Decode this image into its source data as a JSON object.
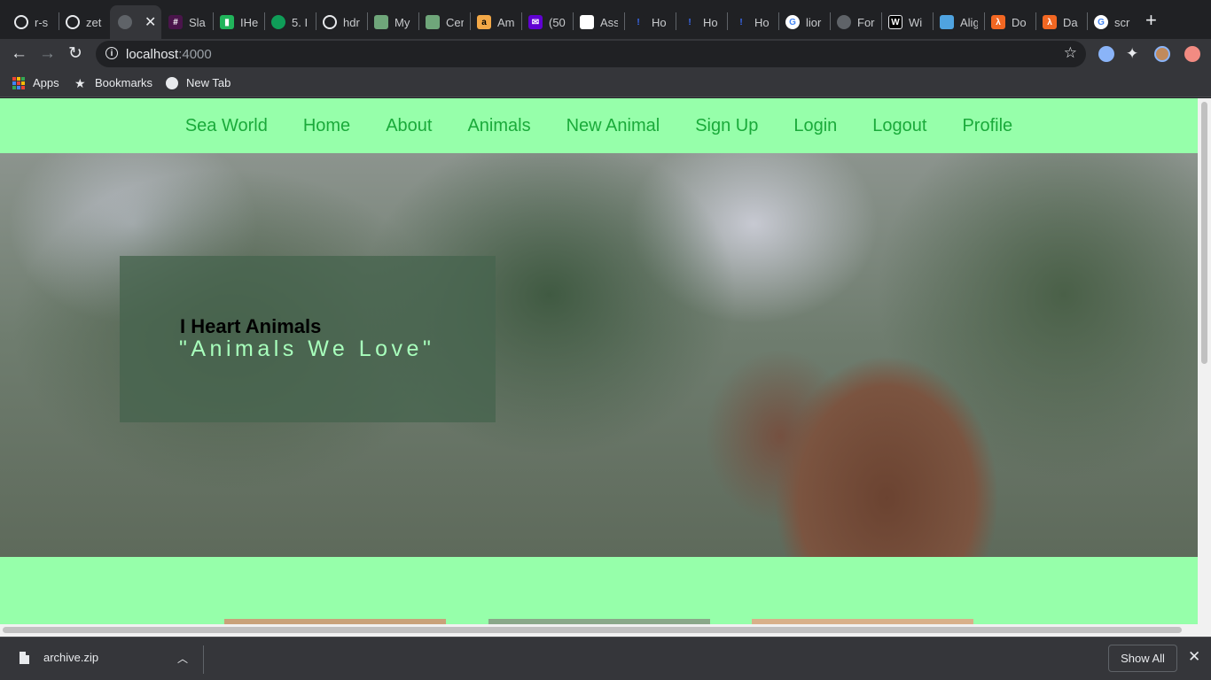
{
  "browser": {
    "tabs": [
      {
        "title": "r-s",
        "icon": "github-icon"
      },
      {
        "title": "zet",
        "icon": "github-icon"
      },
      {
        "title": "",
        "icon": "globe-icon",
        "active": true
      },
      {
        "title": "Sla",
        "icon": "slack-icon"
      },
      {
        "title": "IHe",
        "icon": "trello-icon"
      },
      {
        "title": "5. I",
        "icon": "leaf-icon"
      },
      {
        "title": "hdr",
        "icon": "github-icon"
      },
      {
        "title": "My",
        "icon": "app-icon"
      },
      {
        "title": "Cer",
        "icon": "app-icon"
      },
      {
        "title": "Am",
        "icon": "amazon-icon"
      },
      {
        "title": "(50",
        "icon": "mail-icon"
      },
      {
        "title": "Ass",
        "icon": "doc-icon"
      },
      {
        "title": "Ho",
        "icon": "hotjar-icon"
      },
      {
        "title": "Ho",
        "icon": "hotjar-icon"
      },
      {
        "title": "Ho",
        "icon": "hotjar-icon"
      },
      {
        "title": "lior",
        "icon": "google-icon"
      },
      {
        "title": "For",
        "icon": "globe-icon"
      },
      {
        "title": "Wi",
        "icon": "wiki-icon"
      },
      {
        "title": "Alig",
        "icon": "app-icon"
      },
      {
        "title": "Do",
        "icon": "lambda-icon"
      },
      {
        "title": "Da",
        "icon": "lambda-icon"
      },
      {
        "title": "scr",
        "icon": "google-icon"
      }
    ],
    "url_host": "localhost",
    "url_port": ":4000",
    "bookmarks": [
      {
        "label": "Apps",
        "icon": "apps-grid-icon"
      },
      {
        "label": "Bookmarks",
        "icon": "star-icon"
      },
      {
        "label": "New Tab",
        "icon": "globe-icon"
      }
    ]
  },
  "site": {
    "nav": [
      "Sea World",
      "Home",
      "About",
      "Animals",
      "New Animal",
      "Sign Up",
      "Login",
      "Logout",
      "Profile"
    ],
    "hero": {
      "title": "I Heart Animals",
      "subtitle": "\"Animals We Love\""
    }
  },
  "downloads": {
    "file_name": "archive.zip",
    "show_all_label": "Show All"
  },
  "colors": {
    "page_background": "#96ffaa",
    "nav_link": "#1aaa3a",
    "hero_subtitle": "#a8ffbc"
  }
}
